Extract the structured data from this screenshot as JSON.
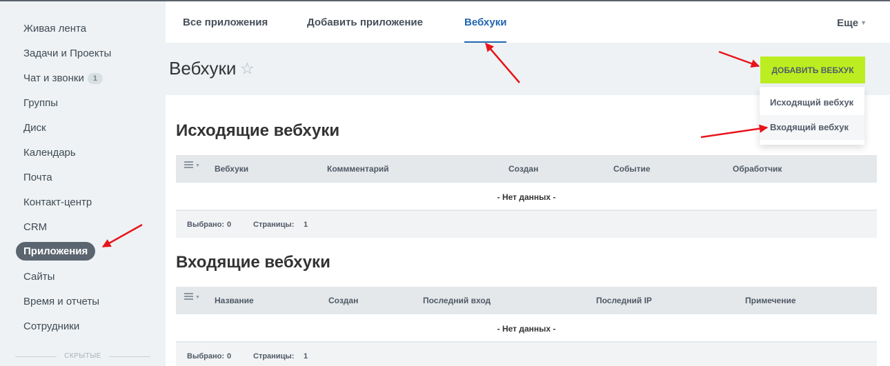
{
  "sidebar": {
    "items": [
      {
        "label": "Живая лента",
        "counter": ""
      },
      {
        "label": "Задачи и Проекты",
        "counter": ""
      },
      {
        "label": "Чат и звонки",
        "counter": "1"
      },
      {
        "label": "Группы",
        "counter": ""
      },
      {
        "label": "Диск",
        "counter": ""
      },
      {
        "label": "Календарь",
        "counter": ""
      },
      {
        "label": "Почта",
        "counter": ""
      },
      {
        "label": "Контакт-центр",
        "counter": ""
      },
      {
        "label": "CRM",
        "counter": ""
      },
      {
        "label": "Приложения",
        "counter": ""
      },
      {
        "label": "Сайты",
        "counter": ""
      },
      {
        "label": "Время и отчеты",
        "counter": ""
      },
      {
        "label": "Сотрудники",
        "counter": ""
      }
    ],
    "hidden_label": "СКРЫТЫЕ"
  },
  "tabs": {
    "items": [
      "Все приложения",
      "Добавить приложение",
      "Вебхуки"
    ],
    "active": "Вебхуки",
    "more": "Еще"
  },
  "page": {
    "title": "Вебхуки",
    "star_icon": "☆",
    "add_button": "Добавить вебхук"
  },
  "dropdown": {
    "items": [
      "Исходящий вебхук",
      "Входящий вебхук"
    ]
  },
  "outgoing": {
    "title": "Исходящие вебхуки",
    "columns": [
      "Вебхуки",
      "Коммментарий",
      "Создан",
      "Событие",
      "Обработчик"
    ],
    "empty": "- Нет данных -",
    "selected_label": "Выбрано:",
    "selected_value": "0",
    "pages_label": "Страницы:",
    "pages_value": "1"
  },
  "incoming": {
    "title": "Входящие вебхуки",
    "columns": [
      "Название",
      "Создан",
      "Последний вход",
      "Последний IP",
      "Примечение"
    ],
    "empty": "- Нет данных -",
    "selected_label": "Выбрано:",
    "selected_value": "0",
    "pages_label": "Страницы:",
    "pages_value": "1"
  },
  "colors": {
    "accent": "#2066b0",
    "add_button": "#bbed21",
    "active_menu": "#5b6570",
    "annotation_arrow": "#e8141b"
  }
}
